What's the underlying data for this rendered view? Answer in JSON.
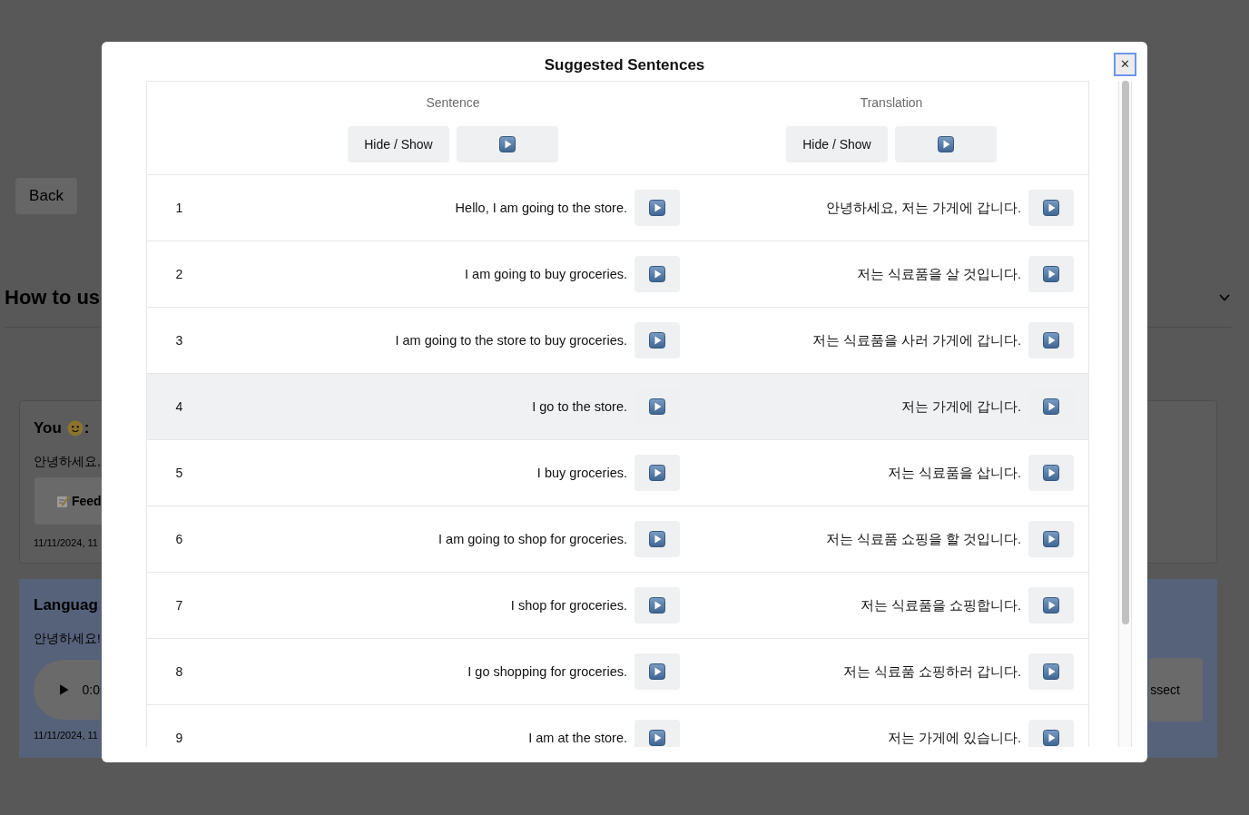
{
  "background_page": {
    "back_button": "Back",
    "heading": "How to us",
    "messages": [
      {
        "kind": "user",
        "author": "You",
        "author_suffix": ":",
        "text": "안녕하세요,",
        "feedback_button": "Feed",
        "timestamp": "11/11/2024, 11"
      },
      {
        "kind": "assistant",
        "author": "Languag",
        "text": "안녕하세요!",
        "audio_time": "0:0",
        "action_button": "ssect",
        "timestamp": "11/11/2024, 11"
      }
    ]
  },
  "modal": {
    "title": "Suggested Sentences",
    "close_button": {
      "label": "✕",
      "focused": true
    },
    "table": {
      "columns": [
        {
          "header": "Sentence",
          "toggle_button": "Hide / Show"
        },
        {
          "header": "Translation",
          "toggle_button": "Hide / Show"
        }
      ],
      "rows": [
        {
          "number": "1",
          "sentence": "Hello, I am going to the store.",
          "translation": "안녕하세요, 저는 가게에 갑니다.",
          "highlighted": false
        },
        {
          "number": "2",
          "sentence": "I am going to buy groceries.",
          "translation": "저는 식료품을 살 것입니다.",
          "highlighted": false
        },
        {
          "number": "3",
          "sentence": "I am going to the store to buy groceries.",
          "translation": "저는 식료품을 사러 가게에 갑니다.",
          "highlighted": false
        },
        {
          "number": "4",
          "sentence": "I go to the store.",
          "translation": "저는 가게에 갑니다.",
          "highlighted": true
        },
        {
          "number": "5",
          "sentence": "I buy groceries.",
          "translation": "저는 식료품을 삽니다.",
          "highlighted": false
        },
        {
          "number": "6",
          "sentence": "I am going to shop for groceries.",
          "translation": "저는 식료품 쇼핑을 할 것입니다.",
          "highlighted": false
        },
        {
          "number": "7",
          "sentence": "I shop for groceries.",
          "translation": "저는 식료품을 쇼핑합니다.",
          "highlighted": false
        },
        {
          "number": "8",
          "sentence": "I go shopping for groceries.",
          "translation": "저는 식료품 쇼핑하러 갑니다.",
          "highlighted": false
        },
        {
          "number": "9",
          "sentence": "I am at the store.",
          "translation": "저는 가게에 있습니다.",
          "highlighted": false
        }
      ]
    }
  }
}
